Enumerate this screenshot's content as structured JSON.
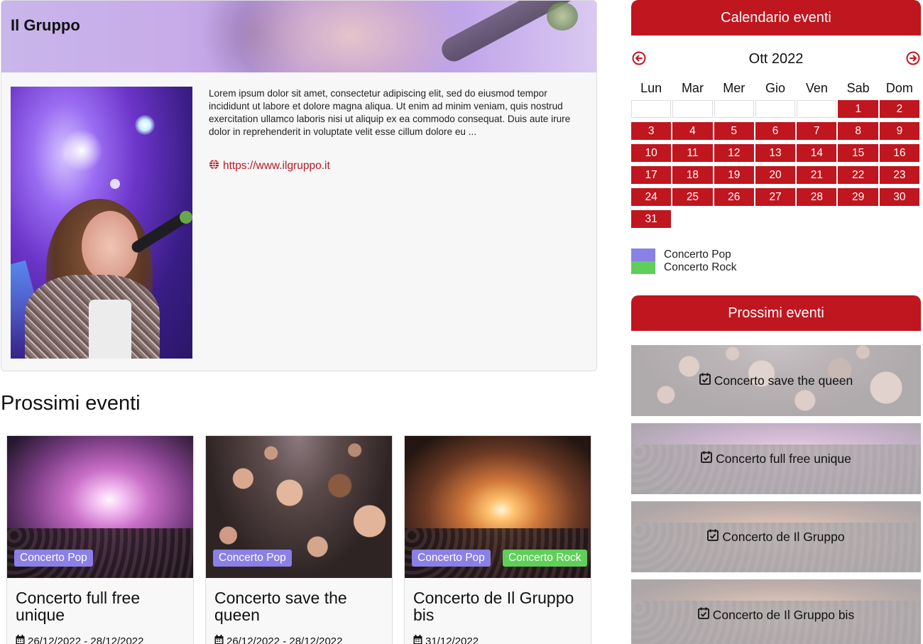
{
  "group": {
    "title": "Il Gruppo",
    "description": "Lorem ipsum dolor sit amet, consectetur adipiscing elit, sed do eiusmod tempor incididunt ut labore et dolore magna aliqua. Ut enim ad minim veniam, quis nostrud exercitation ullamco laboris nisi ut aliquip ex ea commodo consequat. Duis aute irure dolor in reprehenderit in voluptate velit esse cillum dolore eu ...",
    "website": "https://www.ilgruppo.it",
    "website_icon": "globe-icon"
  },
  "events": {
    "heading": "Prossimi eventi",
    "cards": [
      {
        "title": "Concerto full free unique",
        "date": "26/12/2022 - 28/12/2022",
        "badges": [
          "Concerto Pop"
        ]
      },
      {
        "title": "Concerto save the queen",
        "date": "26/12/2022 - 28/12/2022",
        "badges": [
          "Concerto Pop"
        ]
      },
      {
        "title": "Concerto de Il Gruppo bis",
        "date": "31/12/2022",
        "badges": [
          "Concerto Pop",
          "Concerto Rock"
        ]
      }
    ]
  },
  "calendar": {
    "title": "Calendario eventi",
    "month": "Ott 2022",
    "prev_icon": "arrow-left-circle-icon",
    "next_icon": "arrow-right-circle-icon",
    "weekdays": [
      "Lun",
      "Mar",
      "Mer",
      "Gio",
      "Ven",
      "Sab",
      "Dom"
    ],
    "days": [
      "1",
      "2",
      "3",
      "4",
      "5",
      "6",
      "7",
      "8",
      "9",
      "10",
      "11",
      "12",
      "13",
      "14",
      "15",
      "16",
      "17",
      "18",
      "19",
      "20",
      "21",
      "22",
      "23",
      "24",
      "25",
      "26",
      "27",
      "28",
      "29",
      "30",
      "31"
    ],
    "legend": [
      {
        "label": "Concerto Pop",
        "color": "#8a80e6"
      },
      {
        "label": "Concerto Rock",
        "color": "#5fcf5a"
      }
    ]
  },
  "upcoming": {
    "title": "Prossimi eventi",
    "items": [
      {
        "label": "Concerto save the queen"
      },
      {
        "label": "Concerto full free unique"
      },
      {
        "label": "Concerto de Il Gruppo"
      },
      {
        "label": "Concerto de Il Gruppo bis"
      }
    ]
  },
  "colors": {
    "accent": "#c0161f",
    "link": "#b51a23",
    "badge_pop": "#8a80e6",
    "badge_rock": "#5fcf5a"
  }
}
